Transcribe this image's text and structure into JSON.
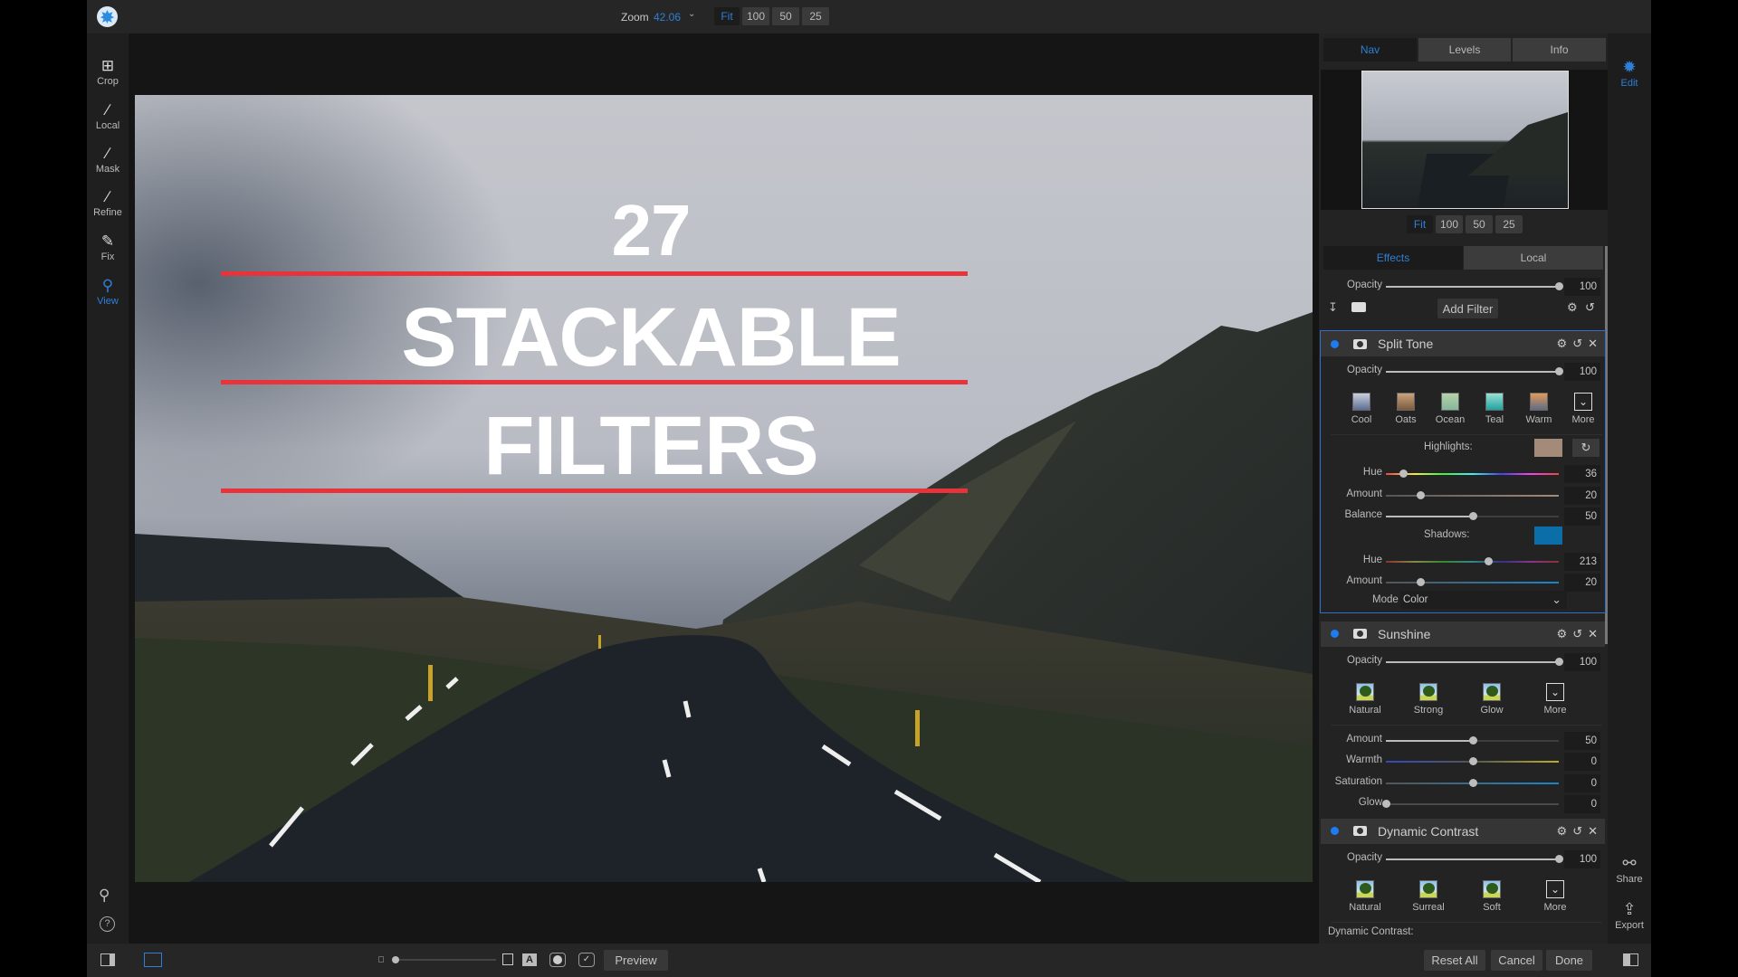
{
  "colors": {
    "accent": "#2f7fd6",
    "highlight_swatch": "#a48a78",
    "shadow_swatch": "#0b6ea6",
    "title_line": "#e8333a"
  },
  "topbar": {
    "zoom_label": "Zoom",
    "zoom_value": "42.06",
    "zoom_buttons": [
      "Fit",
      "100",
      "50",
      "25"
    ],
    "active_zoom": "Fit"
  },
  "left_tools": [
    {
      "label": "Crop",
      "icon": "crop-icon"
    },
    {
      "label": "Local",
      "icon": "brush-icon"
    },
    {
      "label": "Mask",
      "icon": "mask-brush-icon"
    },
    {
      "label": "Refine",
      "icon": "refine-brush-icon"
    },
    {
      "label": "Fix",
      "icon": "bandage-icon"
    },
    {
      "label": "View",
      "icon": "magnifier-icon",
      "active": true
    }
  ],
  "canvas": {
    "headline": [
      "27",
      "STACKABLE",
      "FILTERS"
    ]
  },
  "bottombar": {
    "preview_label": "Preview",
    "reset_label": "Reset All",
    "cancel_label": "Cancel",
    "done_label": "Done"
  },
  "right_strip": {
    "edit_label": "Edit",
    "share_label": "Share",
    "export_label": "Export"
  },
  "nav": {
    "tabs": [
      "Nav",
      "Levels",
      "Info"
    ],
    "active": "Nav",
    "zoom_buttons": [
      "Fit",
      "100",
      "50",
      "25"
    ]
  },
  "effects": {
    "tabs": [
      "Effects",
      "Local"
    ],
    "active": "Effects",
    "opacity_label": "Opacity",
    "opacity": 100,
    "add_filter_label": "Add Filter"
  },
  "filters": [
    {
      "title": "Split Tone",
      "rows": [
        {
          "type": "slider",
          "label": "Opacity",
          "value": 100,
          "min": 0,
          "max": 100,
          "track": "fill"
        },
        {
          "type": "presets",
          "items": [
            {
              "label": "Cool",
              "swatch": "linear-gradient(#c9cfdb,#5d6d93)"
            },
            {
              "label": "Oats",
              "swatch": "linear-gradient(#c9a37b,#7b5a3d)"
            },
            {
              "label": "Ocean",
              "swatch": "linear-gradient(#b7d1a9,#84b79c)"
            },
            {
              "label": "Teal",
              "swatch": "linear-gradient(#9be0d4,#1fa3a0)"
            },
            {
              "label": "Warm",
              "swatch": "linear-gradient(#e29a5a,#5e6b85)"
            },
            {
              "label": "More",
              "swatch": "more"
            }
          ]
        },
        {
          "type": "section",
          "label": "Highlights:",
          "swatch": "#a48a78",
          "reset": true
        },
        {
          "type": "slider",
          "label": "Hue",
          "value": 36,
          "min": 0,
          "max": 360,
          "track": "hue"
        },
        {
          "type": "slider",
          "label": "Amount",
          "value": 20,
          "min": 0,
          "max": 100,
          "track": "tan"
        },
        {
          "type": "slider",
          "label": "Balance",
          "value": 50,
          "min": 0,
          "max": 100,
          "track": "fill"
        },
        {
          "type": "section",
          "label": "Shadows:",
          "swatch": "#0b6ea6"
        },
        {
          "type": "slider",
          "label": "Hue",
          "value": 213,
          "min": 0,
          "max": 360,
          "track": "hue-dark"
        },
        {
          "type": "slider",
          "label": "Amount",
          "value": 20,
          "min": 0,
          "max": 100,
          "track": "blue"
        },
        {
          "type": "mode",
          "label": "Mode",
          "value": "Color"
        }
      ]
    },
    {
      "title": "Sunshine",
      "rows": [
        {
          "type": "slider",
          "label": "Opacity",
          "value": 100,
          "min": 0,
          "max": 100,
          "track": "fill"
        },
        {
          "type": "presets",
          "items": [
            {
              "label": "Natural",
              "swatch": "tree"
            },
            {
              "label": "Strong",
              "swatch": "tree"
            },
            {
              "label": "Glow",
              "swatch": "tree"
            },
            {
              "label": "More",
              "swatch": "more"
            }
          ]
        },
        {
          "type": "slider",
          "label": "Amount",
          "value": 50,
          "min": 0,
          "max": 100,
          "track": "fill"
        },
        {
          "type": "slider",
          "label": "Warmth",
          "value": 0,
          "min": -100,
          "max": 100,
          "track": "warmth"
        },
        {
          "type": "slider",
          "label": "Saturation",
          "value": 0,
          "min": -100,
          "max": 100,
          "track": "blue"
        },
        {
          "type": "slider",
          "label": "Glow",
          "value": 0,
          "min": 0,
          "max": 100,
          "track": "plain"
        }
      ]
    },
    {
      "title": "Dynamic Contrast",
      "rows": [
        {
          "type": "slider",
          "label": "Opacity",
          "value": 100,
          "min": 0,
          "max": 100,
          "track": "fill"
        },
        {
          "type": "presets",
          "items": [
            {
              "label": "Natural",
              "swatch": "tree"
            },
            {
              "label": "Surreal",
              "swatch": "tree"
            },
            {
              "label": "Soft",
              "swatch": "tree"
            },
            {
              "label": "More",
              "swatch": "more"
            }
          ]
        },
        {
          "type": "text",
          "label": "Dynamic Contrast:"
        }
      ]
    }
  ]
}
